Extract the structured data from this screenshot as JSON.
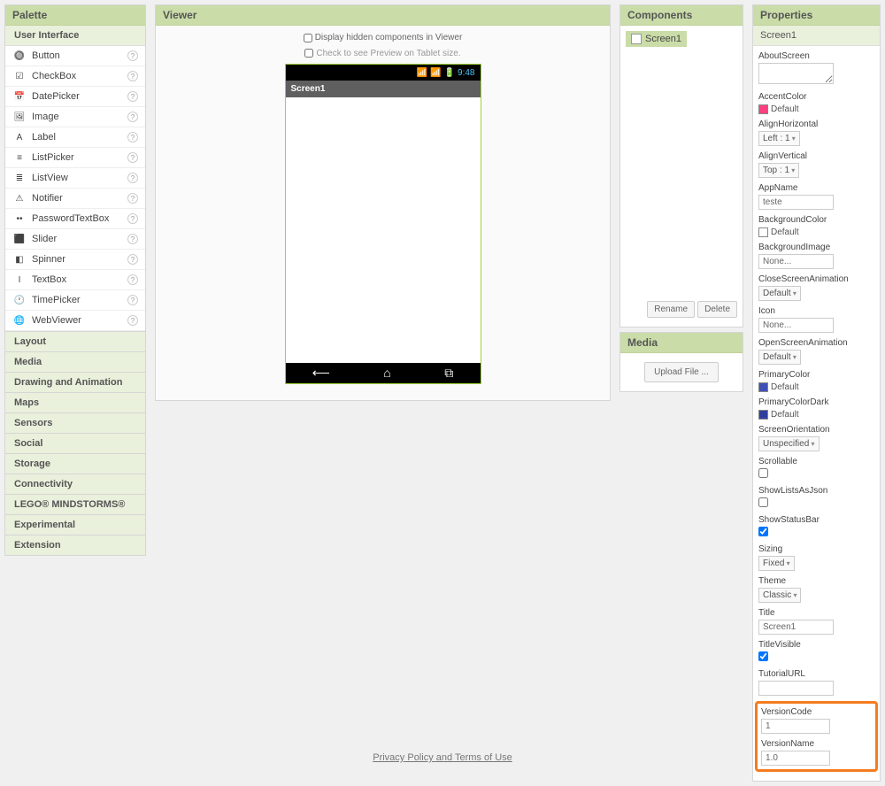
{
  "palette": {
    "title": "Palette",
    "ui_category": "User Interface",
    "items": [
      {
        "label": "Button",
        "icon": "🔘"
      },
      {
        "label": "CheckBox",
        "icon": "☑"
      },
      {
        "label": "DatePicker",
        "icon": "📅"
      },
      {
        "label": "Image",
        "icon": "🖼"
      },
      {
        "label": "Label",
        "icon": "A"
      },
      {
        "label": "ListPicker",
        "icon": "≡"
      },
      {
        "label": "ListView",
        "icon": "≣"
      },
      {
        "label": "Notifier",
        "icon": "⚠"
      },
      {
        "label": "PasswordTextBox",
        "icon": "••"
      },
      {
        "label": "Slider",
        "icon": "⬛"
      },
      {
        "label": "Spinner",
        "icon": "◧"
      },
      {
        "label": "TextBox",
        "icon": "I"
      },
      {
        "label": "TimePicker",
        "icon": "🕐"
      },
      {
        "label": "WebViewer",
        "icon": "🌐"
      }
    ],
    "categories": [
      "Layout",
      "Media",
      "Drawing and Animation",
      "Maps",
      "Sensors",
      "Social",
      "Storage",
      "Connectivity",
      "LEGO® MINDSTORMS®",
      "Experimental",
      "Extension"
    ]
  },
  "viewer": {
    "title": "Viewer",
    "opt_hidden": "Display hidden components in Viewer",
    "opt_tablet": "Check to see Preview on Tablet size.",
    "status_time": "9:48",
    "screen_title": "Screen1"
  },
  "components": {
    "title": "Components",
    "root": "Screen1",
    "rename_btn": "Rename",
    "delete_btn": "Delete"
  },
  "media": {
    "title": "Media",
    "upload_btn": "Upload File ..."
  },
  "properties": {
    "title": "Properties",
    "target": "Screen1",
    "rows": {
      "aboutscreen_label": "AboutScreen",
      "accentcolor_label": "AccentColor",
      "accentcolor_value": "Default",
      "accentcolor_swatch": "#ff4081",
      "alignh_label": "AlignHorizontal",
      "alignh_value": "Left : 1",
      "alignv_label": "AlignVertical",
      "alignv_value": "Top : 1",
      "appname_label": "AppName",
      "appname_value": "teste",
      "bgcolor_label": "BackgroundColor",
      "bgcolor_value": "Default",
      "bgcolor_swatch": "#ffffff",
      "bgimage_label": "BackgroundImage",
      "bgimage_value": "None...",
      "closeanim_label": "CloseScreenAnimation",
      "closeanim_value": "Default",
      "icon_label": "Icon",
      "icon_value": "None...",
      "openanim_label": "OpenScreenAnimation",
      "openanim_value": "Default",
      "primarycolor_label": "PrimaryColor",
      "primarycolor_value": "Default",
      "primarycolor_swatch": "#3f51b5",
      "primarydark_label": "PrimaryColorDark",
      "primarydark_value": "Default",
      "primarydark_swatch": "#303f9f",
      "screenorient_label": "ScreenOrientation",
      "screenorient_value": "Unspecified",
      "scrollable_label": "Scrollable",
      "showlists_label": "ShowListsAsJson",
      "showstatus_label": "ShowStatusBar",
      "sizing_label": "Sizing",
      "sizing_value": "Fixed",
      "theme_label": "Theme",
      "theme_value": "Classic",
      "title_label": "Title",
      "title_value": "Screen1",
      "titlevisible_label": "TitleVisible",
      "tutorialurl_label": "TutorialURL",
      "versioncode_label": "VersionCode",
      "versioncode_value": "1",
      "versionname_label": "VersionName",
      "versionname_value": "1.0"
    }
  },
  "footer": {
    "link": "Privacy Policy and Terms of Use"
  }
}
